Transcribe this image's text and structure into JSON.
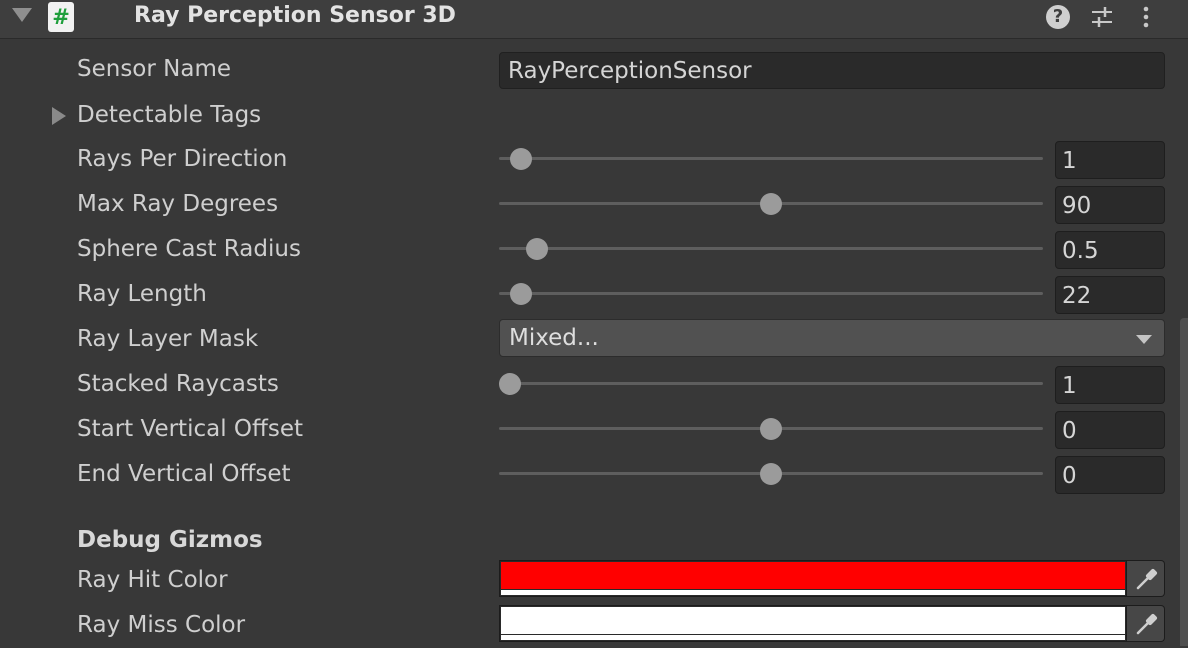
{
  "component": {
    "title": "Ray Perception Sensor 3D",
    "script_icon": "#",
    "icons": [
      "foldout-expanded-icon",
      "script-icon",
      "help-icon",
      "presets-icon",
      "context-menu-icon"
    ]
  },
  "fields": {
    "sensor_name": {
      "label": "Sensor Name",
      "value": "RayPerceptionSensor"
    },
    "detectable_tags": {
      "label": "Detectable Tags"
    },
    "rays_per_direction": {
      "label": "Rays Per Direction",
      "value": "1",
      "fraction": 0.04
    },
    "max_ray_degrees": {
      "label": "Max Ray Degrees",
      "value": "90",
      "fraction": 0.5
    },
    "sphere_cast_radius": {
      "label": "Sphere Cast Radius",
      "value": "0.5",
      "fraction": 0.07
    },
    "ray_length": {
      "label": "Ray Length",
      "value": "22",
      "fraction": 0.04
    },
    "ray_layer_mask": {
      "label": "Ray Layer Mask",
      "value": "Mixed..."
    },
    "stacked_raycasts": {
      "label": "Stacked Raycasts",
      "value": "1",
      "fraction": 0.02
    },
    "start_vertical_offset": {
      "label": "Start Vertical Offset",
      "value": "0",
      "fraction": 0.5
    },
    "end_vertical_offset": {
      "label": "End Vertical Offset",
      "value": "0",
      "fraction": 0.5
    }
  },
  "debug_gizmos": {
    "header": "Debug Gizmos",
    "ray_hit_color": {
      "label": "Ray Hit Color",
      "color": "#ff0000"
    },
    "ray_miss_color": {
      "label": "Ray Miss Color",
      "color": "#ffffff"
    }
  }
}
